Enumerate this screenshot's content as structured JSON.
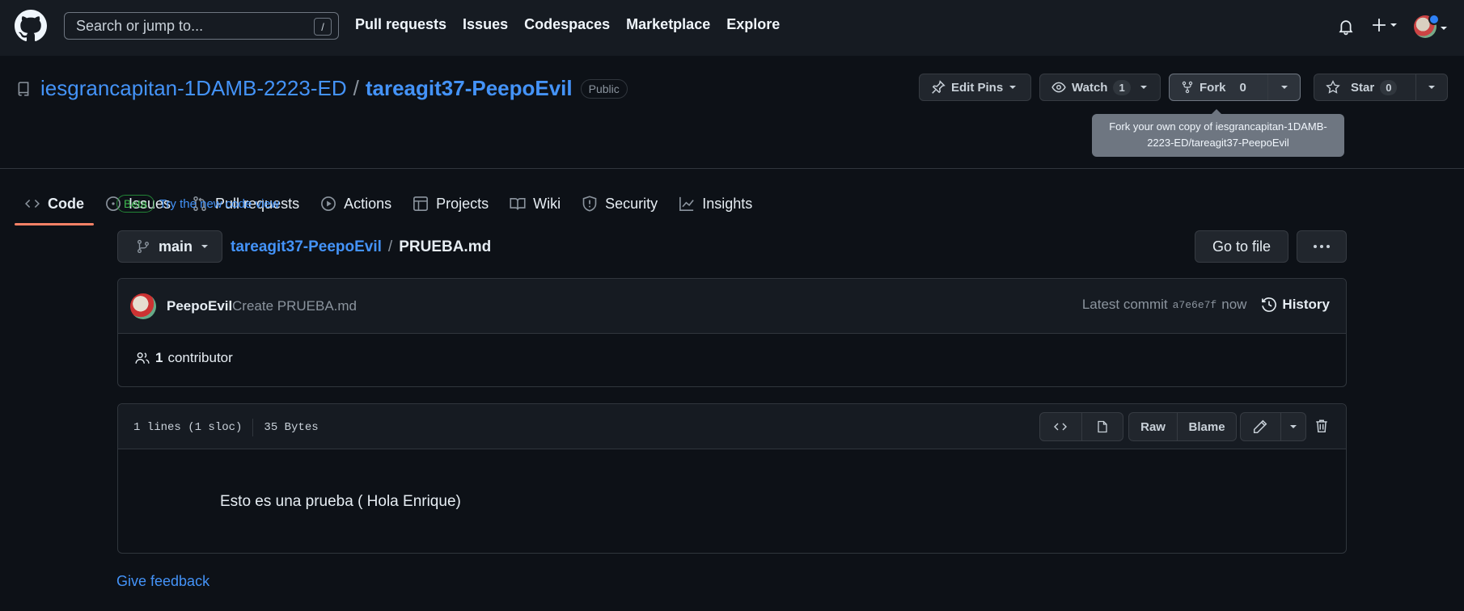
{
  "header": {
    "search_placeholder": "Search or jump to...",
    "search_shortcut": "/",
    "nav": [
      "Pull requests",
      "Issues",
      "Codespaces",
      "Marketplace",
      "Explore"
    ]
  },
  "repo": {
    "owner": "iesgrancapitan-1DAMB-2223-ED",
    "separator": "/",
    "name": "tareagit37-PeepoEvil",
    "visibility": "Public",
    "edit_pins_label": "Edit Pins",
    "watch_label": "Watch",
    "watch_count": "1",
    "fork_label": "Fork",
    "fork_count": "0",
    "star_label": "Star",
    "star_count": "0",
    "fork_tooltip": "Fork your own copy of iesgrancapitan-1DAMB-2223-ED/tareagit37-PeepoEvil"
  },
  "tabs": [
    {
      "label": "Code",
      "icon": "code-icon",
      "active": true
    },
    {
      "label": "Issues",
      "icon": "issue-icon"
    },
    {
      "label": "Pull requests",
      "icon": "pull-request-icon"
    },
    {
      "label": "Actions",
      "icon": "play-icon"
    },
    {
      "label": "Projects",
      "icon": "table-icon"
    },
    {
      "label": "Wiki",
      "icon": "book-icon"
    },
    {
      "label": "Security",
      "icon": "shield-icon"
    },
    {
      "label": "Insights",
      "icon": "graph-icon"
    }
  ],
  "main": {
    "beta_label": "Beta",
    "beta_link": "Try the new code view",
    "branch": "main",
    "crumb_repo": "tareagit37-PeepoEvil",
    "crumb_sep": "/",
    "crumb_file": "PRUEBA.md",
    "goto_file": "Go to file",
    "feedback": "Give feedback"
  },
  "commit": {
    "author": "PeepoEvil",
    "message": "Create PRUEBA.md",
    "latest_label": "Latest commit",
    "hash": "a7e6e7f",
    "time": "now",
    "history_label": "History",
    "contributor_count": "1",
    "contributor_label": "contributor"
  },
  "file": {
    "lines": "1 lines (1 sloc)",
    "size": "35 Bytes",
    "raw_label": "Raw",
    "blame_label": "Blame",
    "content": "Esto es una prueba ( Hola Enrique)"
  },
  "colors": {
    "background": "#0d1117",
    "header": "#161b22",
    "link": "#4493f8",
    "active_tab": "#f78166",
    "beta": "#3fb950"
  }
}
